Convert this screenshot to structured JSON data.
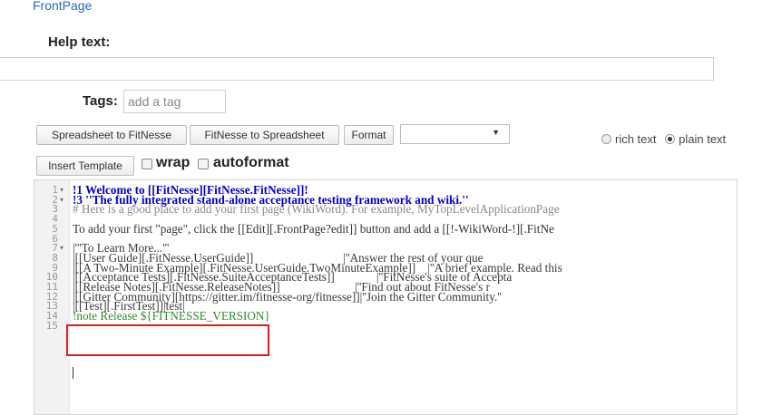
{
  "breadcrumb": "FrontPage",
  "help": {
    "label": "Help text:",
    "value": ""
  },
  "tags": {
    "label": "Tags:",
    "placeholder": "add a tag"
  },
  "toolbar": {
    "spreadsheet_to_fitnesse": "Spreadsheet to FitNesse",
    "fitnesse_to_spreadsheet": "FitNesse to Spreadsheet",
    "format": "Format",
    "format_select_value": "",
    "insert_template": "Insert Template",
    "wrap": "wrap",
    "autoformat": "autoformat",
    "rich_text": "rich text",
    "plain_text": "plain text",
    "selected_mode": "plain text"
  },
  "editor": {
    "lines": [
      {
        "n": "1",
        "fold": true,
        "text": "!1 Welcome to [[FitNesse][FitNesse.FitNesse]]!",
        "style": "heading"
      },
      {
        "n": "2",
        "fold": true,
        "text": "!3 ''The fully integrated stand-alone acceptance testing framework and wiki.''",
        "style": "heading"
      },
      {
        "n": "3",
        "fold": false,
        "text": "# Here is a good place to add your first page (WikiWord). For example, MyTopLevelApplicationPage",
        "style": "comment"
      },
      {
        "n": "4",
        "fold": false,
        "text": "",
        "style": "plain"
      },
      {
        "n": "5",
        "fold": false,
        "text": "To add your first \"page\", click the [[Edit][.FrontPage?edit]] button and add a [[!-WikiWord-!][.FitNe",
        "style": "plain"
      },
      {
        "n": "6",
        "fold": false,
        "text": "",
        "style": "plain"
      },
      {
        "n": "7",
        "fold": true,
        "text": "|'''To Learn More...'''",
        "style": "link"
      },
      {
        "n": "8",
        "fold": false,
        "text": "|[[User Guide][.FitNesse.UserGuide]]                              |''Answer the rest of your que",
        "style": "link"
      },
      {
        "n": "9",
        "fold": false,
        "text": "|[[A Two-Minute Example][.FitNesse.UserGuide.TwoMinuteExample]]    |''A brief example. Read this",
        "style": "link"
      },
      {
        "n": "10",
        "fold": false,
        "text": "|[[Acceptance Tests][.FitNesse.SuiteAcceptanceTests]]              |''FitNesse's suite of Accepta",
        "style": "link"
      },
      {
        "n": "11",
        "fold": false,
        "text": "|[[Release Notes][.FitNesse.ReleaseNotes]]                         |''Find out about FitNesse's r",
        "style": "link"
      },
      {
        "n": "12",
        "fold": false,
        "text": "|[[Gitter Community][https://gitter.im/fitnesse-org/fitnesse]]|''Join the Gitter Community.''",
        "style": "link"
      },
      {
        "n": "13",
        "fold": false,
        "text": "|[[Test][.FirstTest]]|test|",
        "style": "link"
      },
      {
        "n": "14",
        "fold": false,
        "text": "!note Release ${FITNESSE_VERSION}",
        "style": "green"
      },
      {
        "n": "15",
        "fold": false,
        "text": "",
        "style": "plain"
      }
    ]
  },
  "colors": {
    "accent": "#2a6bc4",
    "highlight": "#e01c1c"
  }
}
